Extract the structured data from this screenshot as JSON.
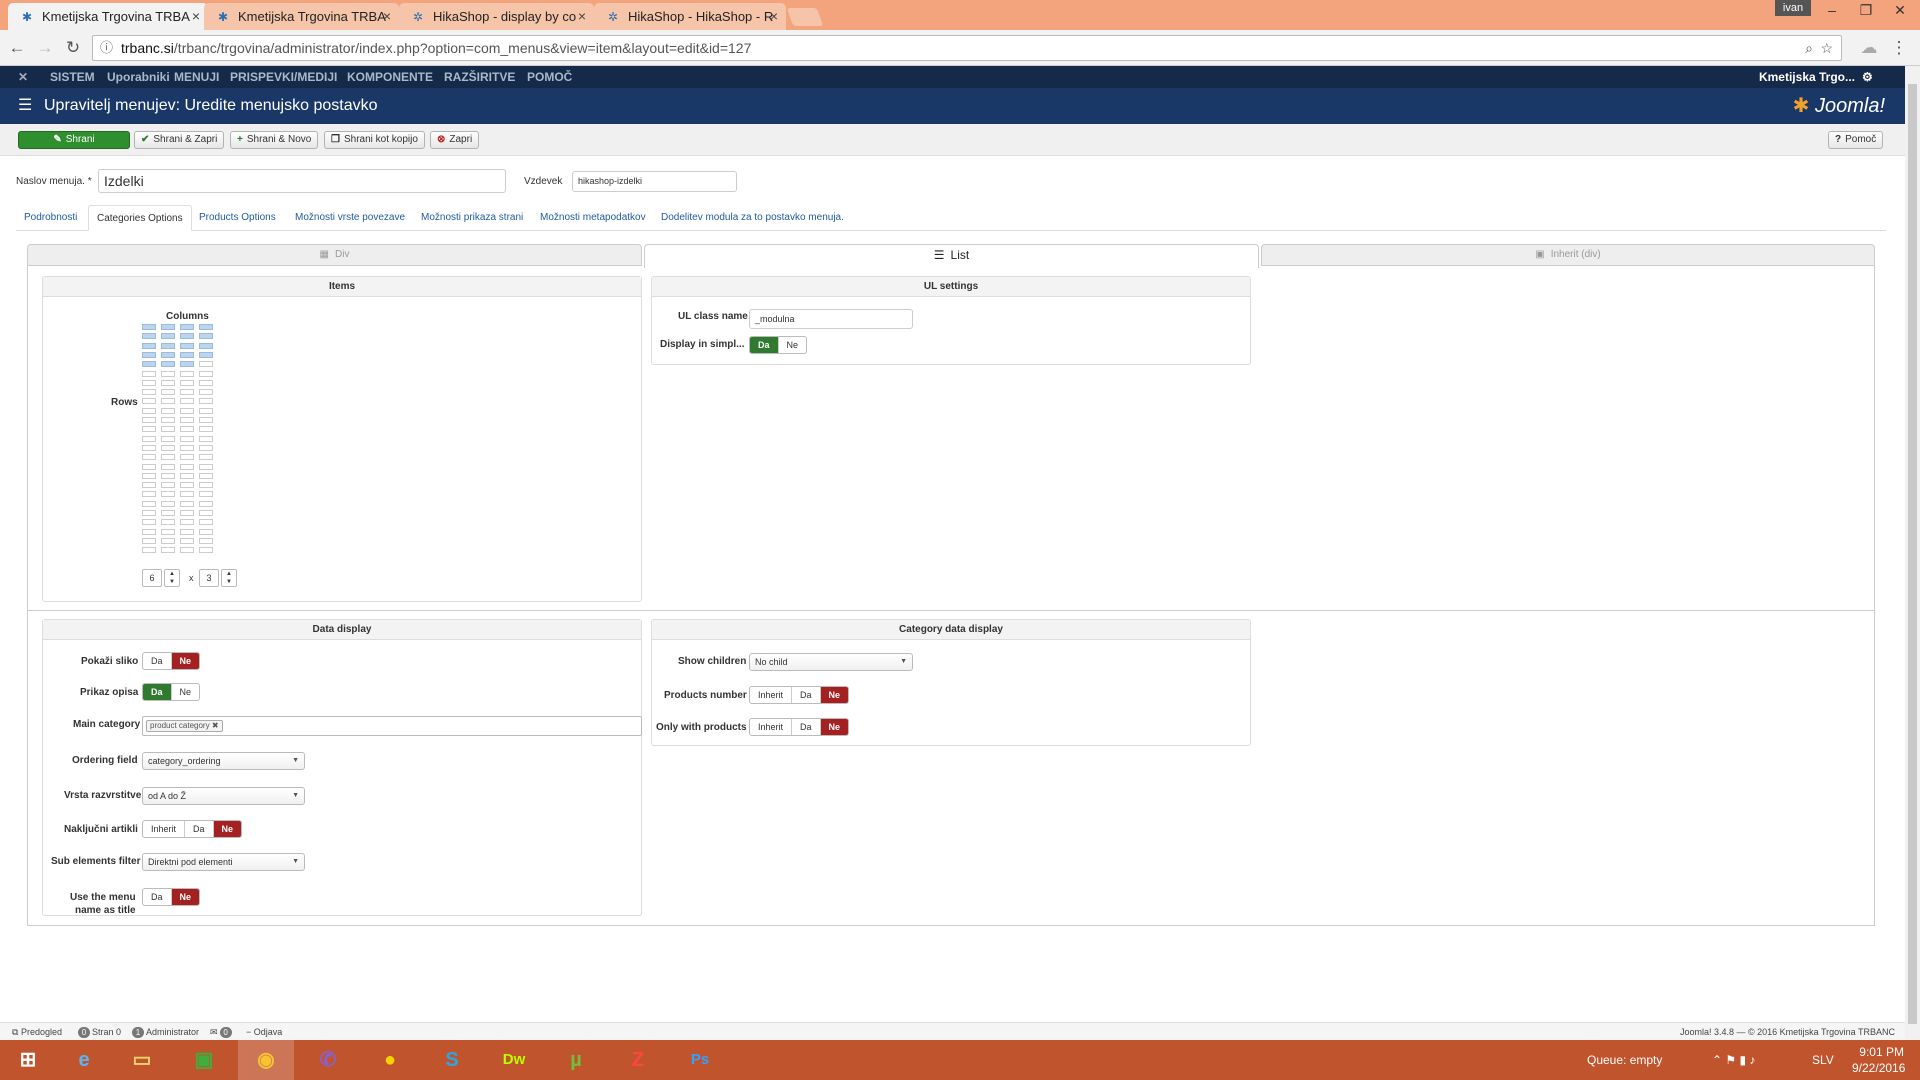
{
  "browser": {
    "tabs": [
      {
        "label": "Kmetijska Trgovina TRBA"
      },
      {
        "label": "Kmetijska Trgovina TRBA"
      },
      {
        "label": "HikaShop - display by co"
      },
      {
        "label": "HikaShop - HikaShop - R"
      }
    ],
    "user": "ivan",
    "url_domain": "trbanc.si",
    "url_path": "/trbanc/trgovina/administrator/index.php?option=com_menus&view=item&layout=edit&id=127"
  },
  "joomla": {
    "menu": [
      "SISTEM",
      "Uporabniki",
      "MENUJI",
      "PRISPEVKI/MEDIJI",
      "KOMPONENTE",
      "RAZŠIRITVE",
      "POMOČ"
    ],
    "site_name": "Kmetijska Trgo...",
    "page_title": "Upravitelj menujev: Uredite menujsko postavko",
    "logo": "Joomla!"
  },
  "toolbar": {
    "save": "Shrani",
    "save_close": "Shrani & Zapri",
    "save_new": "Shrani & Novo",
    "save_copy": "Shrani kot kopijo",
    "close": "Zapri",
    "help": "Pomoč"
  },
  "form": {
    "title_label": "Naslov menuja. *",
    "title_value": "Izdelki",
    "alias_label": "Vzdevek",
    "alias_value": "hikashop-izdelki"
  },
  "tabs": [
    "Podrobnosti",
    "Categories Options",
    "Products Options",
    "Možnosti vrste povezave",
    "Možnosti prikaza strani",
    "Možnosti metapodatkov",
    "Dodelitev modula za to postavko menuja."
  ],
  "layout_tabs": {
    "div": "Div",
    "list": "List",
    "inherit": "Inherit (div)"
  },
  "items_panel": {
    "title": "Items",
    "columns_label": "Columns",
    "rows_label": "Rows",
    "rows_value": "6",
    "x_label": "x",
    "cols_value": "3",
    "spin_up": "▲",
    "spin_down": "▼"
  },
  "ul_panel": {
    "title": "UL settings",
    "class_label": "UL class name",
    "class_value": "_modulna",
    "simple_label": "Display in simpl...",
    "da": "Da",
    "ne": "Ne"
  },
  "data_display": {
    "title": "Data display",
    "pokazi_slika": "Pokaži sliko",
    "prikaz_opisa": "Prikaz opisa",
    "main_category": "Main category",
    "main_category_tag": "product category",
    "ordering_field": "Ordering field",
    "ordering_value": "category_ordering",
    "vrsta": "Vrsta razvrstitve",
    "vrsta_value": "od A do Ž",
    "nakljucni": "Naključni artikli",
    "sub_filter": "Sub elements filter",
    "sub_filter_value": "Direktni pod elementi",
    "use_menu_1": "Use the menu",
    "use_menu_2": "name as title",
    "inherit": "Inherit",
    "da": "Da",
    "ne": "Ne"
  },
  "category_display": {
    "title": "Category data display",
    "show_children": "Show children",
    "show_children_value": "No child",
    "products_number": "Products number",
    "only_with_products": "Only with products",
    "inherit": "Inherit",
    "da": "Da",
    "ne": "Ne"
  },
  "status": {
    "preview": "Predogled",
    "n1": "0",
    "visitors": "Stran 0",
    "n2": "1",
    "admin": "Administrator",
    "n3": "0",
    "logout": "Odjava",
    "version": "Joomla! 3.4.8 — © 2016 Kmetijska Trgovina TRBANC"
  },
  "taskbar": {
    "queue": "Queue: empty",
    "lang": "SLV",
    "time": "9:01 PM",
    "date": "9/22/2016"
  }
}
